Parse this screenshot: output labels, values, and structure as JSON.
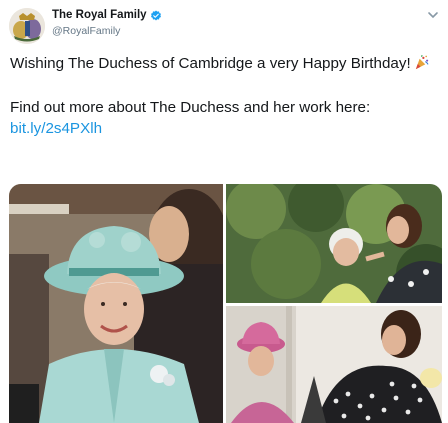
{
  "account": {
    "name": "The Royal Family",
    "handle": "@RoyalFamily",
    "verified": true,
    "avatar_icon": "royal-family-crest"
  },
  "tweet": {
    "line1": "Wishing The Duchess of Cambridge a very Happy Birthday!",
    "emoji_icon": "party-popper-icon",
    "line2": "Find out more about The Duchess and her work here:",
    "link": "bit.ly/2s4PXlh"
  },
  "media": {
    "photo_count": 3
  },
  "colors": {
    "text": "#14171a",
    "secondary": "#657786",
    "link": "#1b95e0",
    "verified": "#1da1f2"
  }
}
